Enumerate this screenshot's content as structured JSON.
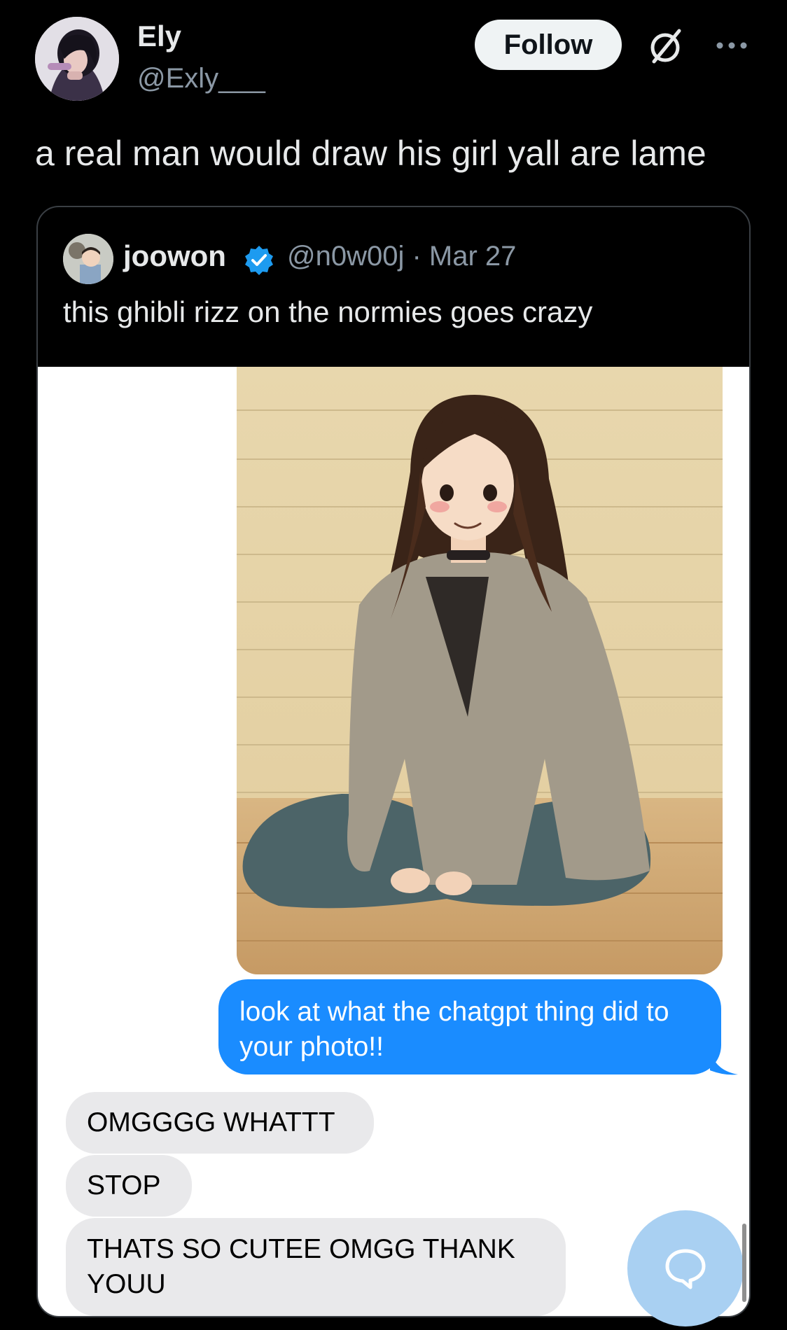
{
  "post": {
    "author_name": "Ely",
    "author_handle": "@Exly___",
    "follow_label": "Follow",
    "text": "a real man would draw his girl yall are lame"
  },
  "quote": {
    "author_name": "joowon",
    "author_handle": "@n0w00j",
    "separator": " · ",
    "date": "Mar 27",
    "text": "this ghibli rizz on the normies goes crazy"
  },
  "chat": {
    "sent_message": "look at what the chatgpt thing did to your photo!!",
    "received_messages": [
      "OMGGGG WHATTT",
      "STOP",
      "THATS SO CUTEE OMGG THANK YOUU"
    ]
  },
  "icons": {
    "grok": "grok-icon",
    "more": "more-options-icon",
    "verified": "verified-badge-icon",
    "reply": "reply-bubble-icon"
  },
  "colors": {
    "background": "#000000",
    "verified_blue": "#1d9bf0",
    "imessage_blue": "#1a8cff",
    "received_bubble": "#e9e9eb",
    "handle_gray": "#8b98a5"
  }
}
